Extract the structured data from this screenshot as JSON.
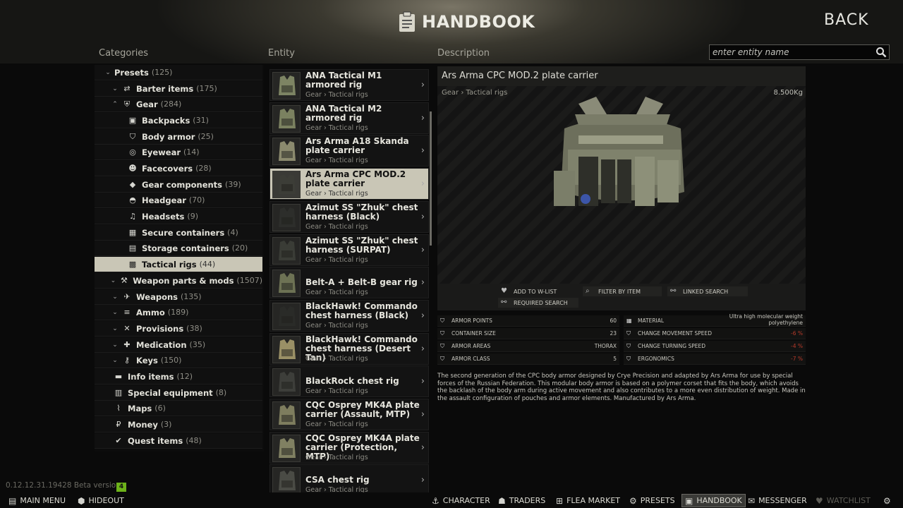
{
  "header": {
    "title": "HANDBOOK",
    "back_label": "BACK"
  },
  "columns": {
    "categories": "Categories",
    "entity": "Entity",
    "description": "Description"
  },
  "search": {
    "placeholder": "enter entity name"
  },
  "categories": [
    {
      "label": "Presets",
      "count": "(125)",
      "arrow": "⌄",
      "icon": "none",
      "indent": 0
    },
    {
      "label": "Barter items",
      "count": "(175)",
      "arrow": "⌄",
      "icon": "barter-icon",
      "indent": 1
    },
    {
      "label": "Gear",
      "count": "(284)",
      "arrow": "⌃",
      "icon": "gear-vest-icon",
      "indent": 1
    },
    {
      "label": "Backpacks",
      "count": "(31)",
      "arrow": "",
      "icon": "backpack-icon",
      "indent": 2
    },
    {
      "label": "Body armor",
      "count": "(25)",
      "arrow": "",
      "icon": "body-armor-icon",
      "indent": 2
    },
    {
      "label": "Eyewear",
      "count": "(14)",
      "arrow": "",
      "icon": "eyewear-icon",
      "indent": 2
    },
    {
      "label": "Facecovers",
      "count": "(28)",
      "arrow": "",
      "icon": "facecover-icon",
      "indent": 2
    },
    {
      "label": "Gear components",
      "count": "(39)",
      "arrow": "",
      "icon": "gear-components-icon",
      "indent": 2
    },
    {
      "label": "Headgear",
      "count": "(70)",
      "arrow": "",
      "icon": "headgear-icon",
      "indent": 2
    },
    {
      "label": "Headsets",
      "count": "(9)",
      "arrow": "",
      "icon": "headset-icon",
      "indent": 2
    },
    {
      "label": "Secure containers",
      "count": "(4)",
      "arrow": "",
      "icon": "secure-container-icon",
      "indent": 2
    },
    {
      "label": "Storage containers",
      "count": "(20)",
      "arrow": "",
      "icon": "storage-container-icon",
      "indent": 2
    },
    {
      "label": "Tactical rigs",
      "count": "(44)",
      "arrow": "",
      "icon": "tactical-rig-icon",
      "indent": 2,
      "selected": true
    },
    {
      "label": "Weapon parts & mods",
      "count": "(1507)",
      "arrow": "⌄",
      "icon": "weapon-parts-icon",
      "indent": 1
    },
    {
      "label": "Weapons",
      "count": "(135)",
      "arrow": "⌄",
      "icon": "weapons-icon",
      "indent": 1
    },
    {
      "label": "Ammo",
      "count": "(189)",
      "arrow": "⌄",
      "icon": "ammo-icon",
      "indent": 1
    },
    {
      "label": "Provisions",
      "count": "(38)",
      "arrow": "⌄",
      "icon": "provisions-icon",
      "indent": 1
    },
    {
      "label": "Medication",
      "count": "(35)",
      "arrow": "⌄",
      "icon": "medication-icon",
      "indent": 1
    },
    {
      "label": "Keys",
      "count": "(150)",
      "arrow": "⌄",
      "icon": "keys-icon",
      "indent": 1
    },
    {
      "label": "Info items",
      "count": "(12)",
      "arrow": "",
      "icon": "info-items-icon",
      "indent": 0
    },
    {
      "label": "Special equipment",
      "count": "(8)",
      "arrow": "",
      "icon": "special-equipment-icon",
      "indent": 0
    },
    {
      "label": "Maps",
      "count": "(6)",
      "arrow": "",
      "icon": "maps-icon",
      "indent": 0
    },
    {
      "label": "Money",
      "count": "(3)",
      "arrow": "",
      "icon": "money-icon",
      "indent": 0
    },
    {
      "label": "Quest items",
      "count": "(48)",
      "arrow": "",
      "icon": "quest-items-icon",
      "indent": 0
    }
  ],
  "entities": [
    {
      "name": "ANA Tactical M1 armored rig",
      "path": "Gear › Tactical rigs"
    },
    {
      "name": "ANA Tactical M2 armored rig",
      "path": "Gear › Tactical rigs"
    },
    {
      "name": "Ars Arma A18 Skanda plate carrier",
      "path": "Gear › Tactical rigs"
    },
    {
      "name": "Ars Arma CPC MOD.2 plate carrier",
      "path": "Gear › Tactical rigs",
      "selected": true
    },
    {
      "name": "Azimut SS \"Zhuk\" chest harness (Black)",
      "path": "Gear › Tactical rigs"
    },
    {
      "name": "Azimut SS \"Zhuk\" chest harness (SURPAT)",
      "path": "Gear › Tactical rigs"
    },
    {
      "name": "Belt-A + Belt-B gear rig",
      "path": "Gear › Tactical rigs",
      "single": true
    },
    {
      "name": "BlackHawk! Commando chest harness (Black)",
      "path": "Gear › Tactical rigs"
    },
    {
      "name": "BlackHawk! Commando chest harness (Desert Tan)",
      "path": "Gear › Tactical rigs"
    },
    {
      "name": "BlackRock chest rig",
      "path": "Gear › Tactical rigs",
      "single": true
    },
    {
      "name": "CQC Osprey MK4A plate carrier (Assault, MTP)",
      "path": "Gear › Tactical rigs"
    },
    {
      "name": "CQC Osprey MK4A plate carrier (Protection, MTP)",
      "path": "Gear › Tactical rigs"
    },
    {
      "name": "CSA chest rig",
      "path": "Gear › Tactical rigs",
      "single": true
    }
  ],
  "description": {
    "title": "Ars Arma CPC MOD.2 plate carrier",
    "path": "Gear › Tactical rigs",
    "weight": "8.500Kg",
    "actions": {
      "add_wlist": "ADD TO W-LIST",
      "filter": "FILTER BY ITEM",
      "linked": "LINKED SEARCH",
      "required": "REQUIRED SEARCH"
    },
    "stats_left": [
      {
        "label": "ARMOR POINTS",
        "value": "60"
      },
      {
        "label": "CONTAINER SIZE",
        "value": "23"
      },
      {
        "label": "ARMOR AREAS",
        "value": "THORAX"
      },
      {
        "label": "ARMOR CLASS",
        "value": "5"
      }
    ],
    "stats_right": [
      {
        "label": "MATERIAL",
        "value": "Ultra high molecular weight polyethylene"
      },
      {
        "label": "CHANGE MOVEMENT SPEED",
        "value": "-6 %"
      },
      {
        "label": "CHANGE TURNING SPEED",
        "value": "-4 %"
      },
      {
        "label": "ERGONOMICS",
        "value": "-7 %"
      }
    ],
    "text": "The second generation of the CPC body armor designed by Crye Precision and adapted by Ars Arma for use by special forces of the Russian Federation. This modular body armor is based on a polymer corset that fits the body, which avoids the backlash of the body arm during active movement and also contributes to a more even distribution of weight. Made in the assault configuration of pouches and armor elements. Manufactured by Ars Arma."
  },
  "footer": {
    "version": "0.12.12.31.19428 Beta version",
    "badge": "4",
    "main_menu": "MAIN MENU",
    "hideout": "HIDEOUT",
    "character": "CHARACTER",
    "traders": "TRADERS",
    "flea_market": "FLEA MARKET",
    "presets": "PRESETS",
    "handbook": "HANDBOOK",
    "messenger": "MESSENGER",
    "watchlist": "WATCHLIST"
  },
  "colors": {
    "selected_bg": "#c9c6b6",
    "negative": "#b83a2a",
    "badge": "#6db21a"
  }
}
